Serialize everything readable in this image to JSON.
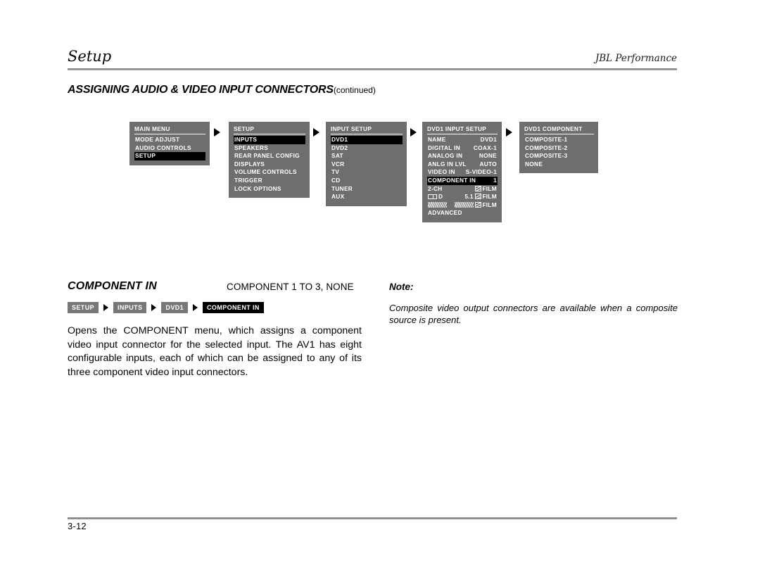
{
  "header": {
    "title": "Setup",
    "brand": "JBL Performance"
  },
  "section": {
    "heading": "ASSIGNING AUDIO & VIDEO INPUT CONNECTORS",
    "continued": "(continued)"
  },
  "osd_menus": [
    {
      "id": "main-menu",
      "title": "MAIN MENU",
      "rows": [
        {
          "label": "MODE ADJUST",
          "value": "",
          "selected": false
        },
        {
          "label": "AUDIO CONTROLS",
          "value": "",
          "selected": false
        },
        {
          "label": "SETUP",
          "value": "",
          "selected": true
        }
      ]
    },
    {
      "id": "setup-menu",
      "title": "SETUP",
      "rows": [
        {
          "label": "INPUTS",
          "value": "",
          "selected": true
        },
        {
          "label": "SPEAKERS",
          "value": "",
          "selected": false
        },
        {
          "label": "REAR PANEL CONFIG",
          "value": "",
          "selected": false
        },
        {
          "label": "DISPLAYS",
          "value": "",
          "selected": false
        },
        {
          "label": "VOLUME CONTROLS",
          "value": "",
          "selected": false
        },
        {
          "label": "TRIGGER",
          "value": "",
          "selected": false
        },
        {
          "label": "LOCK OPTIONS",
          "value": "",
          "selected": false
        }
      ]
    },
    {
      "id": "input-setup-menu",
      "title": "INPUT SETUP",
      "rows": [
        {
          "label": "DVD1",
          "value": "",
          "selected": true
        },
        {
          "label": "DVD2",
          "value": "",
          "selected": false
        },
        {
          "label": "SAT",
          "value": "",
          "selected": false
        },
        {
          "label": "VCR",
          "value": "",
          "selected": false
        },
        {
          "label": "TV",
          "value": "",
          "selected": false
        },
        {
          "label": "CD",
          "value": "",
          "selected": false
        },
        {
          "label": "TUNER",
          "value": "",
          "selected": false
        },
        {
          "label": "AUX",
          "value": "",
          "selected": false
        }
      ]
    },
    {
      "id": "dvd1-input-setup-menu",
      "title": "DVD1 INPUT SETUP",
      "rows": [
        {
          "label": "NAME",
          "value": "DVD1",
          "selected": false
        },
        {
          "label": "DIGITAL IN",
          "value": "COAX-1",
          "selected": false
        },
        {
          "label": "ANALOG IN",
          "value": "NONE",
          "selected": false
        },
        {
          "label": "ANLG IN LVL",
          "value": "AUTO",
          "selected": false
        },
        {
          "label": "VIDEO IN",
          "value": "S-VIDEO-1",
          "selected": false
        },
        {
          "label": "COMPONENT IN",
          "value": "1",
          "selected": true
        },
        {
          "label": "2-CH",
          "value": "FILM",
          "value_icon": "film-icon",
          "selected": false
        },
        {
          "label": "D",
          "label_icon": "dolby-digital-icon",
          "value": "5.1 FILM",
          "value_icon": "film-icon",
          "selected": false
        },
        {
          "label": "",
          "label_icon": "dts-logo-icon",
          "value": "FILM",
          "value_icon": "film-icon",
          "value_prefix_icon": "dts-logo-icon",
          "selected": false
        },
        {
          "label": "ADVANCED",
          "value": "",
          "selected": false
        }
      ]
    },
    {
      "id": "dvd1-component-menu",
      "title": "DVD1 COMPONENT",
      "rows": [
        {
          "label": "COMPOSITE-1",
          "value": "",
          "selected": false
        },
        {
          "label": "COMPOSITE-2",
          "value": "",
          "selected": false
        },
        {
          "label": "COMPOSITE-3",
          "value": "",
          "selected": false
        },
        {
          "label": "NONE",
          "value": "",
          "selected": false
        }
      ]
    }
  ],
  "feature": {
    "name": "COMPONENT IN",
    "values": "COMPONENT 1 TO 3, NONE",
    "breadcrumb": [
      {
        "label": "SETUP",
        "active": false
      },
      {
        "label": "INPUTS",
        "active": false
      },
      {
        "label": "DVD1",
        "active": false
      },
      {
        "label": "COMPONENT IN",
        "active": true
      }
    ],
    "description": "Opens the COMPONENT menu, which assigns a component video input connector for the selected input. The AV1 has eight configurable inputs, each of which can be assigned to any of its three component video input connectors."
  },
  "note": {
    "title": "Note:",
    "text": "Composite video output connectors are available when a composite source is present."
  },
  "footer": {
    "page_number": "3-12"
  },
  "colors": {
    "osd_background": "#6e6e6e",
    "osd_selected": "#000000",
    "osd_text": "#ffffff",
    "crumb_background": "#777777",
    "crumb_active": "#000000",
    "rule": "#7d7d7d"
  }
}
